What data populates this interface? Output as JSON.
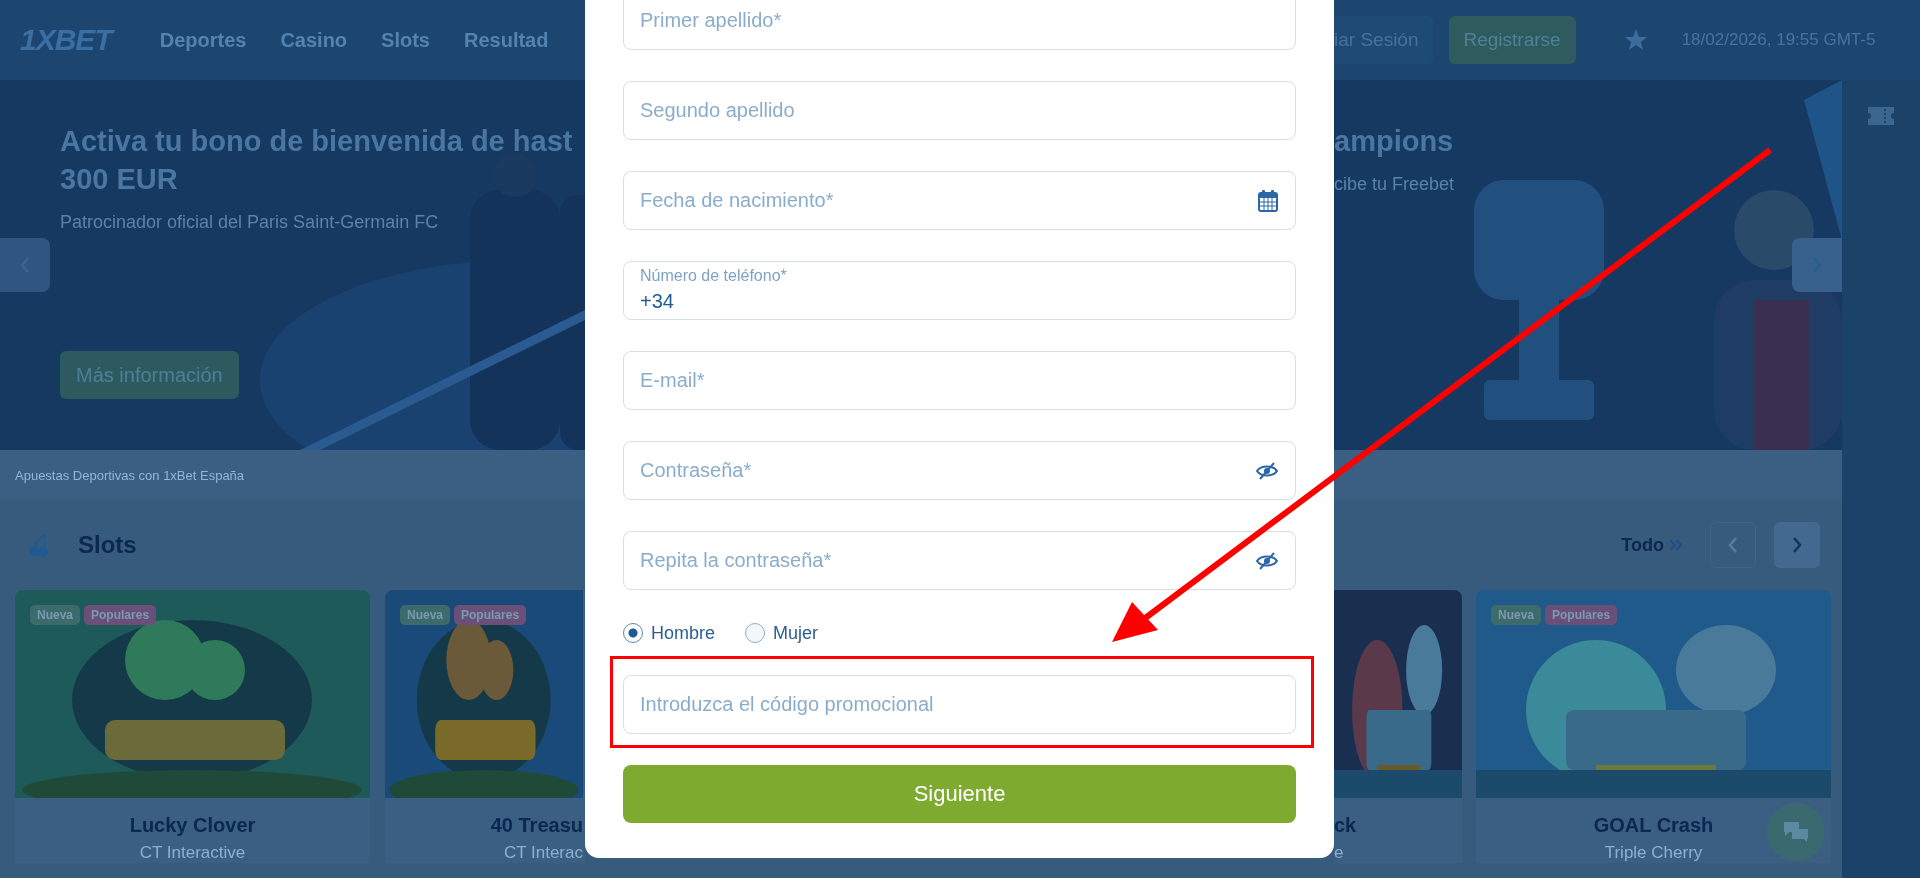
{
  "header": {
    "logo": "1XBET",
    "nav": [
      {
        "label": "Deportes"
      },
      {
        "label": "Casino"
      },
      {
        "label": "Slots"
      },
      {
        "label": "Resultad"
      }
    ],
    "login_button": "iar Sesión",
    "register_button": "Registrarse",
    "datetime": "18/02/2026, 19:55 GMT-5"
  },
  "banner_left": {
    "title_lines": [
      "Activa tu bono de bienvenida de hast",
      "300 EUR"
    ],
    "subtitle": "Patrocinador oficial del Paris Saint-Germain FC",
    "button": "Más información"
  },
  "banner_right": {
    "title": "ampions",
    "subtitle": "cibe tu Freebet"
  },
  "breadcrumb": "Apuestas Deportivas con 1xBet España",
  "slots": {
    "title": "Slots",
    "all_link": "Todo",
    "nav_buttons": [
      {
        "kind": "prev",
        "disabled": true
      },
      {
        "kind": "next",
        "disabled": false
      }
    ]
  },
  "games_left": [
    {
      "title": "Lucky Clover",
      "provider": "CT Interactive",
      "badges": [
        {
          "label": "Nueva",
          "color": "#3d6a6b"
        },
        {
          "label": "Populares",
          "color": "#6a4f79"
        }
      ]
    },
    {
      "title": "40 Treasu",
      "provider": "CT Interac",
      "badges": [
        {
          "label": "Nueva",
          "color": "#3d6a6b"
        },
        {
          "label": "Populares",
          "color": "#6a4f79"
        }
      ]
    }
  ],
  "games_right": [
    {
      "title": "ck",
      "provider": "e"
    },
    {
      "title": "GOAL Crash",
      "provider": "Triple Cherry",
      "badges": [
        {
          "label": "Nueva",
          "color": "#3d6a6b"
        },
        {
          "label": "Populares",
          "color": "#6a4f79"
        }
      ]
    }
  ],
  "form": {
    "fields": [
      {
        "kind": "text",
        "placeholder": "Primer apellido*"
      },
      {
        "kind": "text",
        "placeholder": "Segundo apellido"
      },
      {
        "kind": "date",
        "placeholder": "Fecha de nacimiento*"
      },
      {
        "kind": "phone",
        "label": "Número de teléfono*",
        "value": "+34"
      },
      {
        "kind": "text",
        "placeholder": "E-mail*"
      },
      {
        "kind": "password",
        "placeholder": "Contraseña*"
      },
      {
        "kind": "password",
        "placeholder": "Repita la contraseña*"
      }
    ],
    "gender": [
      {
        "label": "Hombre",
        "selected": true
      },
      {
        "label": "Mujer",
        "selected": false
      }
    ],
    "promo": {
      "placeholder": "Introduzca el código promocional",
      "highlighted": true
    },
    "submit": "Siguiente"
  }
}
